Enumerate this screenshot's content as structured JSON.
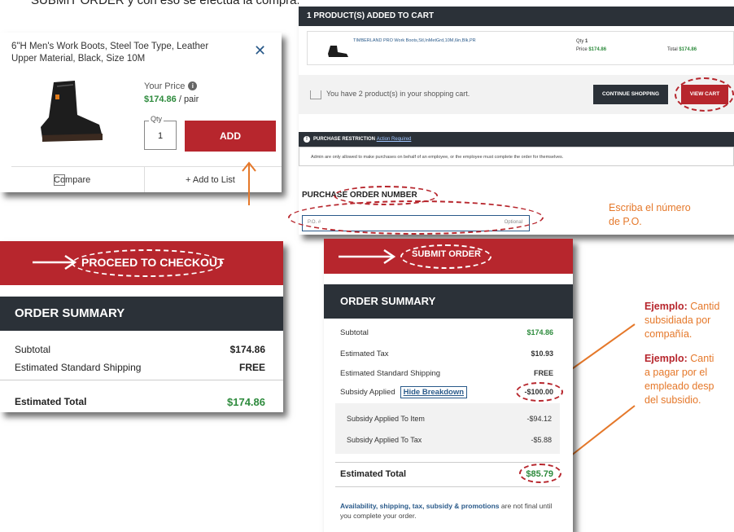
{
  "top_caption": "SUBMIT ORDER y con eso se efectúa la compra.",
  "card": {
    "title": "6\"H Men's Work Boots, Steel Toe Type, Leather Upper Material, Black, Size 10M",
    "close_icon": "close-icon",
    "your_price_label": "Your Price",
    "price": "$174.86",
    "unit": "/ pair",
    "qty_label": "Qty",
    "qty_value": "1",
    "add_label": "ADD",
    "compare_label": "Compare",
    "add_to_list_label": "+ Add to List"
  },
  "cart": {
    "header": "1 PRODUCT(S) ADDED TO CART",
    "product_name": "TIMBERLAND PRO Work Boots,Stl,InMetGrd,10M,6in,Blk,PR",
    "qty_label": "Qty",
    "qty_value": "1",
    "price_label": "Price",
    "price_value": "$174.86",
    "total_label": "Total",
    "total_value": "$174.86",
    "in_cart_text": "You have 2 product(s) in your shopping cart.",
    "continue_label": "CONTINUE SHOPPING",
    "view_cart_label": "VIEW CART",
    "restriction_label": "PURCHASE RESTRICTION",
    "restriction_link": "Action Required",
    "admin_text": "Admin are only allowed to make purchases on behalf of an employee, or the employee must complete the order for themselves.",
    "po_title": "PURCHASE ORDER NUMBER",
    "po_placeholder": "P.O. #",
    "po_optional": "Optional"
  },
  "proceed": {
    "button_label": "PROCEED TO CHECKOUT",
    "summary_title": "ORDER SUMMARY",
    "subtotal_label": "Subtotal",
    "subtotal_value": "$174.86",
    "shipping_label": "Estimated Standard Shipping",
    "shipping_value": "FREE",
    "total_label": "Estimated Total",
    "total_value": "$174.86"
  },
  "submit": {
    "button_label": "SUBMIT ORDER",
    "summary_title": "ORDER SUMMARY",
    "subtotal_label": "Subtotal",
    "subtotal_value": "$174.86",
    "tax_label": "Estimated Tax",
    "tax_value": "$10.93",
    "shipping_label": "Estimated Standard Shipping",
    "shipping_value": "FREE",
    "subsidy_label": "Subsidy Applied",
    "hide_breakdown": "Hide Breakdown",
    "subsidy_value": "-$100.00",
    "item_label": "Subsidy Applied To Item",
    "item_value": "-$94.12",
    "tax_sub_label": "Subsidy Applied To Tax",
    "tax_sub_value": "-$5.88",
    "total_label": "Estimated Total",
    "total_value": "$85.79",
    "note_bold": "Availability, shipping, tax, subsidy & promotions",
    "note_rest": " are not final until you complete your order."
  },
  "annotations": {
    "po_note_1": "Escriba el número",
    "po_note_2": "de  P.O.",
    "ex1_bold": "Ejemplo:",
    "ex1_rest": " Cantid",
    "ex1_line2": "subsidiada por",
    "ex1_line3": "compañía.",
    "ex2_bold": "Ejemplo:",
    "ex2_rest": " Canti",
    "ex2_line2": "a pagar por el",
    "ex2_line3": "empleado desp",
    "ex2_line4": "del subsidio."
  },
  "colors": {
    "brand_red": "#b7262d",
    "dark": "#2b3138",
    "green": "#2e8b3d",
    "annotation_orange": "#e5782a"
  }
}
